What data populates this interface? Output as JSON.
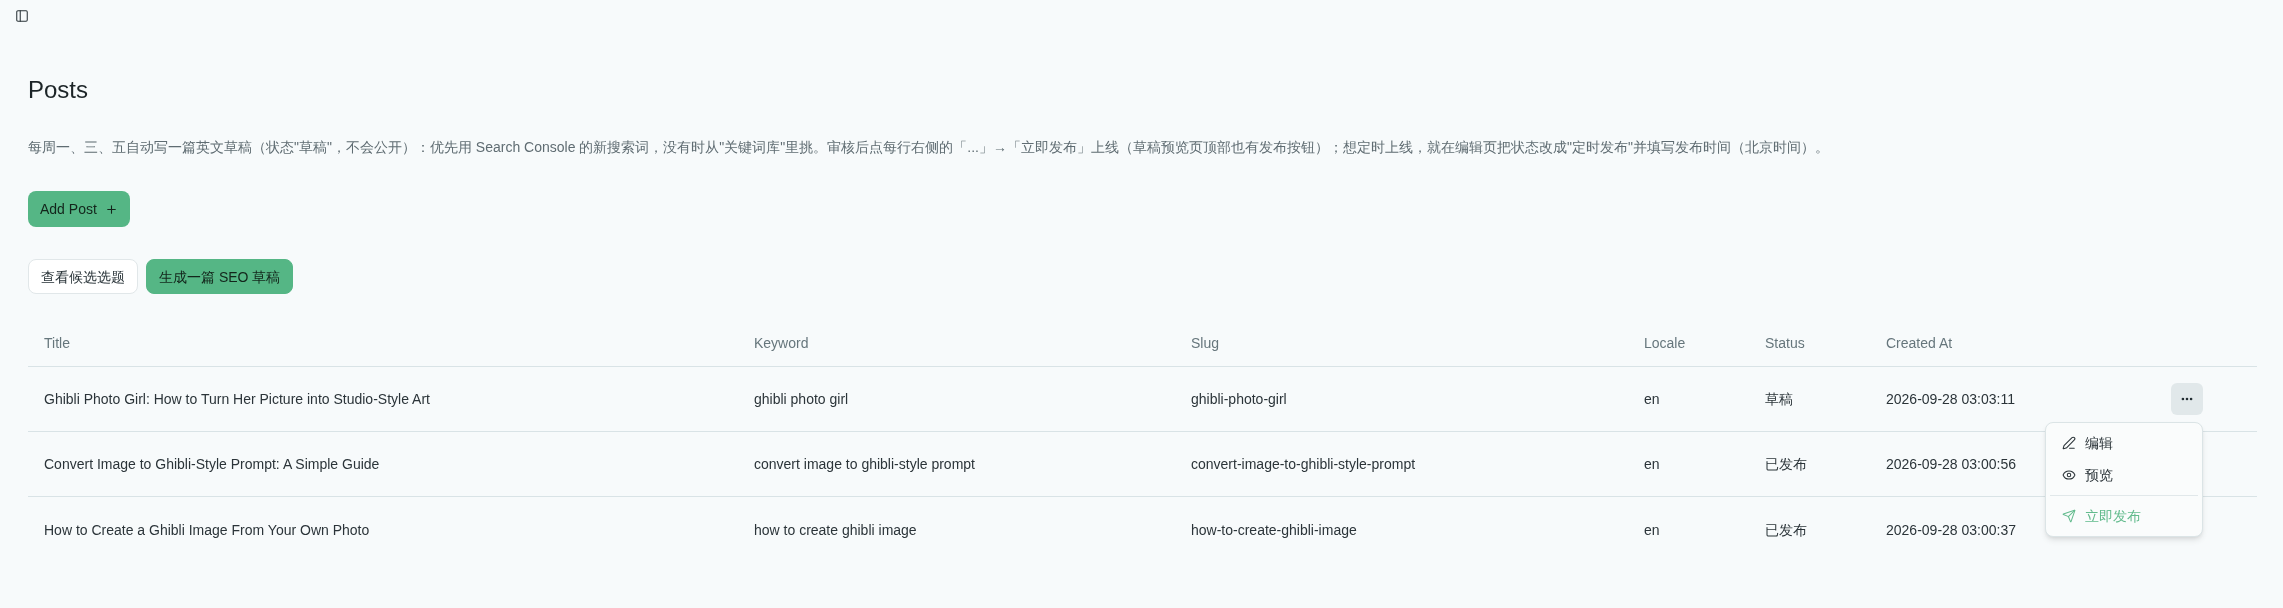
{
  "page": {
    "title": "Posts",
    "description": "每周一、三、五自动写一篇英文草稿（状态\"草稿\"，不会公开）：优先用 Search Console 的新搜索词，没有时从\"关键词库\"里挑。审核后点每行右侧的「...」→「立即发布」上线（草稿预览页顶部也有发布按钮）；想定时上线，就在编辑页把状态改成\"定时发布\"并填写发布时间（北京时间）。"
  },
  "add_button": {
    "label": "Add Post"
  },
  "toolbar": [
    {
      "label": "查看候选选题",
      "kind": "outline"
    },
    {
      "label": "生成一篇 SEO 草稿",
      "kind": "primary"
    }
  ],
  "table": {
    "columns": [
      "Title",
      "Keyword",
      "Slug",
      "Locale",
      "Status",
      "Created At"
    ],
    "rows": [
      {
        "cells": [
          "Ghibli Photo Girl: How to Turn Her Picture into Studio-Style Art",
          "ghibli photo girl",
          "ghibli-photo-girl",
          "en",
          "草稿",
          "2026-09-28 03:03:11"
        ],
        "menu": {
          "open": true,
          "groups": [
            [
              {
                "label": "编辑",
                "kind": "edit"
              },
              {
                "label": "预览",
                "kind": "preview"
              }
            ],
            [
              {
                "label": "立即发布",
                "kind": "publish"
              }
            ]
          ]
        }
      },
      {
        "cells": [
          "Convert Image to Ghibli-Style Prompt: A Simple Guide",
          "convert image to ghibli-style prompt",
          "convert-image-to-ghibli-style-prompt",
          "en",
          "已发布",
          "2026-09-28 03:00:56"
        ]
      },
      {
        "cells": [
          "How to Create a Ghibli Image From Your Own Photo",
          "how to create ghibli image",
          "how-to-create-ghibli-image",
          "en",
          "已发布",
          "2026-09-28 03:00:37"
        ]
      }
    ]
  }
}
